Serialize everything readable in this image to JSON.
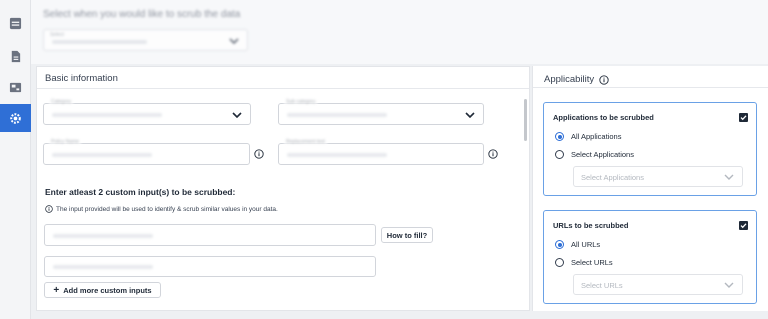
{
  "nav": {
    "items": [
      {
        "icon": "dashboard-icon",
        "active": false
      },
      {
        "icon": "document-icon",
        "active": false
      },
      {
        "icon": "image-icon",
        "active": false
      },
      {
        "icon": "gear-icon",
        "active": true
      }
    ]
  },
  "top": {
    "title": "Select when you would like to scrub the data",
    "select_label": "Select"
  },
  "basic": {
    "header": "Basic information",
    "category_label": "Category",
    "subcategory_label": "Sub category",
    "policy_label": "Policy Name",
    "replacement_label": "Replacement text",
    "custom_heading": "Enter atleast 2 custom input(s) to be scrubbed:",
    "custom_note": "The input provided will be used to identify & scrub similar values in your data.",
    "how_to_fill": "How to fill?",
    "add_more": "Add more custom inputs"
  },
  "applicability": {
    "header": "Applicability",
    "apps": {
      "title": "Applications to be scrubbed",
      "checked": true,
      "options": [
        "All Applications",
        "Select Applications"
      ],
      "selected": "All Applications",
      "placeholder": "Select Applications"
    },
    "urls": {
      "title": "URLs to be scrubbed",
      "checked": true,
      "options": [
        "All URLs",
        "Select URLs"
      ],
      "selected": "All URLs",
      "placeholder": "Select URLs"
    }
  },
  "colors": {
    "accent": "#2f6fd6",
    "card_border": "#6aa1e6"
  }
}
